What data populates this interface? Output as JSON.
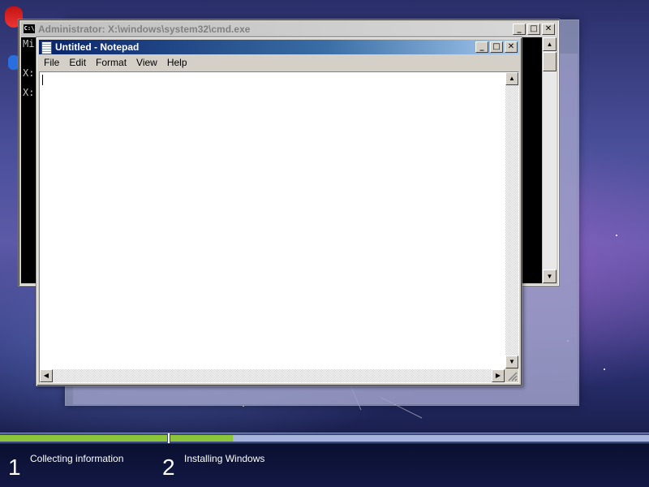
{
  "cmd": {
    "title": "Administrator: X:\\windows\\system32\\cmd.exe",
    "icon_text": "C:\\",
    "lines": [
      "Mi",
      "X:",
      "X:"
    ]
  },
  "notepad": {
    "title": "Untitled - Notepad",
    "menu": [
      "File",
      "Edit",
      "Format",
      "View",
      "Help"
    ],
    "content": ""
  },
  "window_buttons": {
    "minimize": "_",
    "maximize": "□",
    "close": "✕"
  },
  "setup": {
    "steps": [
      {
        "number": "1",
        "label": "Collecting information"
      },
      {
        "number": "2",
        "label": "Installing Windows"
      }
    ],
    "progress": {
      "step1": 1.0,
      "step2": 0.13
    }
  },
  "colors": {
    "accent_green": "#8cc43a",
    "notepad_title_start": "#0a246a",
    "notepad_title_end": "#a6caf0"
  }
}
